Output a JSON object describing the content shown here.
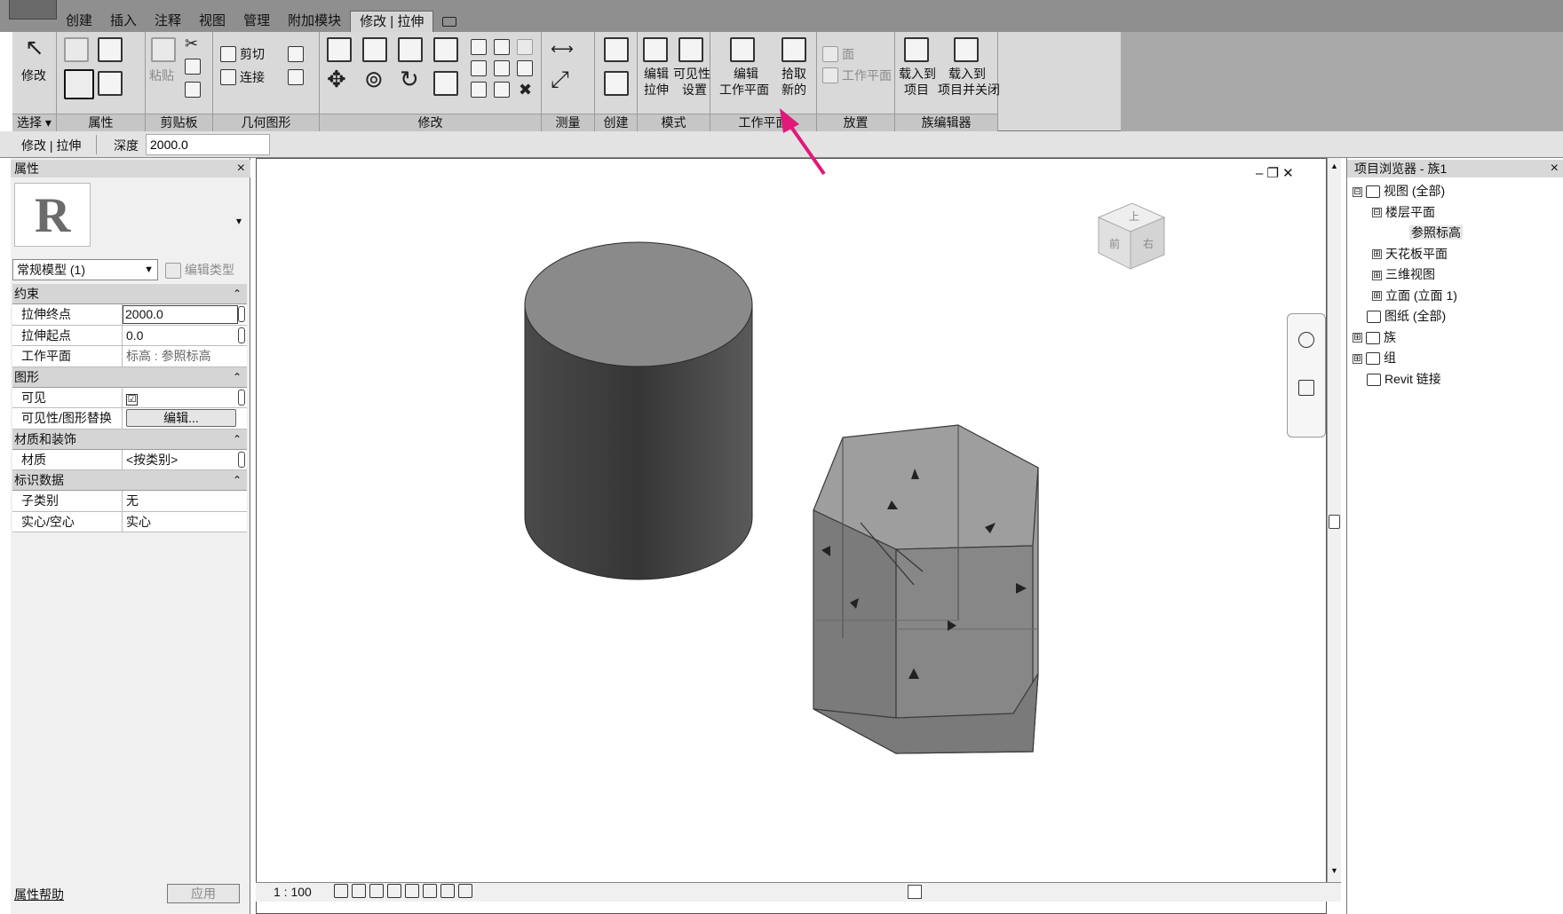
{
  "tabs": [
    "创建",
    "插入",
    "注释",
    "视图",
    "管理",
    "附加模块",
    "修改 | 拉伸"
  ],
  "active_tab": "修改 | 拉伸",
  "ribbon": {
    "panels": {
      "select": "选择 ▾",
      "properties": "属性",
      "clipboard": "剪贴板",
      "geometry": "几何图形",
      "modify": "修改",
      "measure": "测量",
      "create": "创建",
      "mode": "模式",
      "workplane": "工作平面",
      "place": "放置",
      "family_editor": "族编辑器"
    },
    "buttons": {
      "modify": "修改",
      "paste": "粘贴",
      "cut": "剪切",
      "join": "连接",
      "edit_extrusion_1": "编辑",
      "edit_extrusion_2": "拉伸",
      "visibility_1": "可见性",
      "visibility_2": "设置",
      "edit_workplane_1": "编辑",
      "edit_workplane_2": "工作平面",
      "pick_new_1": "拾取",
      "pick_new_2": "新的",
      "face": "面",
      "work_plane": "工作平面",
      "load_project_1": "载入到",
      "load_project_2": "项目",
      "load_close_1": "载入到",
      "load_close_2": "项目并关闭"
    }
  },
  "options_bar": {
    "context": "修改 | 拉伸",
    "depth_label": "深度",
    "depth_value": "2000.0"
  },
  "properties": {
    "title": "属性",
    "type_name": "常规模型 (1)",
    "edit_type": "编辑类型",
    "groups": [
      {
        "name": "约束",
        "rows": [
          {
            "name": "拉伸终点",
            "value": "2000.0"
          },
          {
            "name": "拉伸起点",
            "value": "0.0"
          },
          {
            "name": "工作平面",
            "value": "标高 : 参照标高"
          }
        ]
      },
      {
        "name": "图形",
        "rows": [
          {
            "name": "可见",
            "value": "☑"
          },
          {
            "name": "可见性/图形替换",
            "value": "编辑..."
          }
        ]
      },
      {
        "name": "材质和装饰",
        "rows": [
          {
            "name": "材质",
            "value": "<按类别>"
          }
        ]
      },
      {
        "name": "标识数据",
        "rows": [
          {
            "name": "子类别",
            "value": "无"
          },
          {
            "name": "实心/空心",
            "value": "实心"
          }
        ]
      }
    ],
    "help": "属性帮助",
    "apply": "应用"
  },
  "viewport": {
    "scale": "1 : 100",
    "view_cube": {
      "top": "上",
      "front": "前",
      "right": "右"
    }
  },
  "browser": {
    "title": "项目浏览器 - 族1",
    "nodes": [
      {
        "label": "视图 (全部)",
        "level": 0,
        "pm": "⊟"
      },
      {
        "label": "楼层平面",
        "level": 1,
        "pm": "⊟"
      },
      {
        "label": "参照标高",
        "level": 2,
        "pm": ""
      },
      {
        "label": "天花板平面",
        "level": 1,
        "pm": "⊞"
      },
      {
        "label": "三维视图",
        "level": 1,
        "pm": "⊞"
      },
      {
        "label": "立面 (立面 1)",
        "level": 1,
        "pm": "⊞"
      },
      {
        "label": "图纸 (全部)",
        "level": 0,
        "pm": ""
      },
      {
        "label": "族",
        "level": 0,
        "pm": "⊞"
      },
      {
        "label": "组",
        "level": 0,
        "pm": "⊞"
      },
      {
        "label": "Revit 链接",
        "level": 0,
        "pm": ""
      }
    ]
  },
  "colors": {
    "annotation_arrow": "#e0187a",
    "ribbon_bg": "#d9d9d9",
    "tab_bg": "#8f8f8f"
  }
}
